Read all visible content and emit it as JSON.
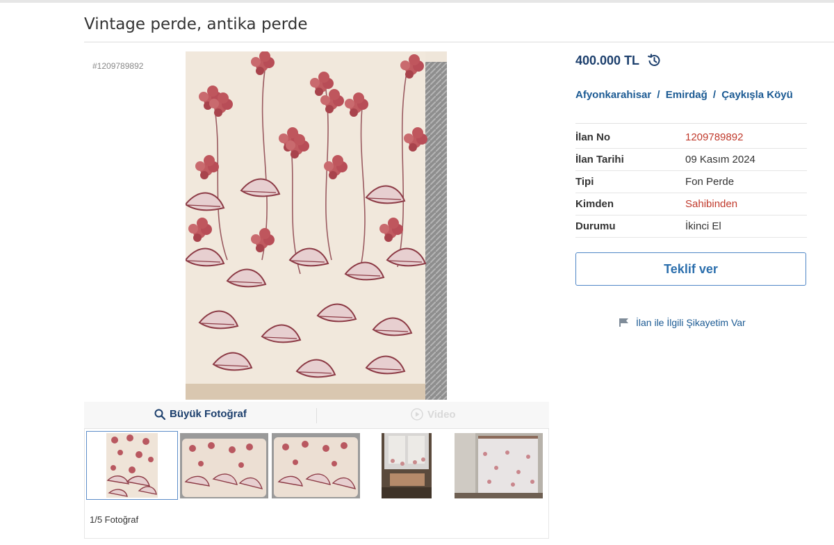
{
  "listing": {
    "title": "Vintage perde, antika perde",
    "number_tag": "#1209789892"
  },
  "gallery": {
    "big_photo_label": "Büyük Fotoğraf",
    "video_label": "Video",
    "photo_count": "1/5 Fotoğraf",
    "thumbnails": [
      "curtain-fabric-front",
      "curtain-fabric-draped-1",
      "curtain-fabric-draped-2",
      "curtain-on-window-small",
      "curtain-hung-in-room"
    ]
  },
  "price": {
    "amount": "400.000 TL",
    "history_icon": "history-icon"
  },
  "location": {
    "province": "Afyonkarahisar",
    "district": "Emirdağ",
    "village": "Çaykışla Köyü",
    "separator": "/"
  },
  "details": [
    {
      "label": "İlan No",
      "value": "1209789892",
      "color": "#c0392b"
    },
    {
      "label": "İlan Tarihi",
      "value": "09 Kasım 2024",
      "color": "#333333"
    },
    {
      "label": "Tipi",
      "value": "Fon Perde",
      "color": "#333333"
    },
    {
      "label": "Kimden",
      "value": "Sahibinden",
      "color": "#c0392b"
    },
    {
      "label": "Durumu",
      "value": "İkinci El",
      "color": "#333333"
    }
  ],
  "actions": {
    "offer_label": "Teklif ver",
    "complaint_label": "İlan ile İlgili Şikayetim Var"
  },
  "colors": {
    "brand_navy": "#1b3e6c",
    "link_blue": "#1b5a93",
    "accent_red": "#c0392b",
    "button_border": "#4f86c6"
  }
}
